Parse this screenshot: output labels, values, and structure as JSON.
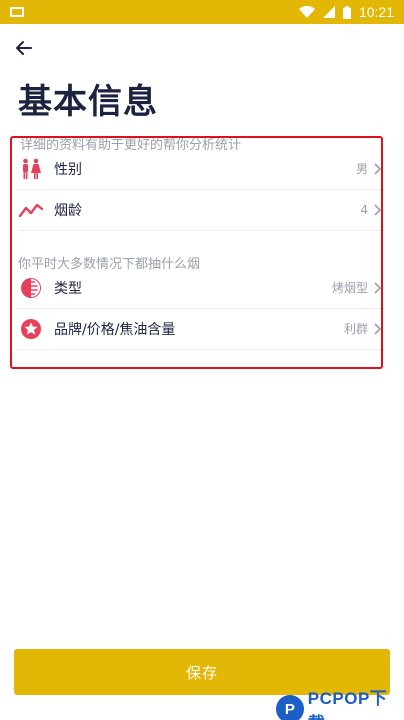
{
  "status": {
    "time": "10:21"
  },
  "page": {
    "title": "基本信息",
    "hint": "详细的资料有助于更好的帮你分析统计"
  },
  "rows_basic": [
    {
      "label": "性别",
      "value": "男",
      "icon": "gender-icon"
    },
    {
      "label": "烟龄",
      "value": "4",
      "icon": "trend-line-icon"
    }
  ],
  "habits": {
    "title": "你平时大多数情况下都抽什么烟",
    "rows": [
      {
        "label": "类型",
        "value": "烤烟型",
        "icon": "half-circle-icon"
      },
      {
        "label": "品牌/价格/焦油含量",
        "value": "利群",
        "icon": "star-badge-icon"
      }
    ]
  },
  "actions": {
    "save_label": "保存"
  },
  "watermark": {
    "text": "PCPOP下载"
  },
  "colors": {
    "accent": "#e3b705",
    "icon_red": "#e8405a",
    "highlight": "#e0101a",
    "title": "#1c2340",
    "muted": "#9aa0ab"
  }
}
